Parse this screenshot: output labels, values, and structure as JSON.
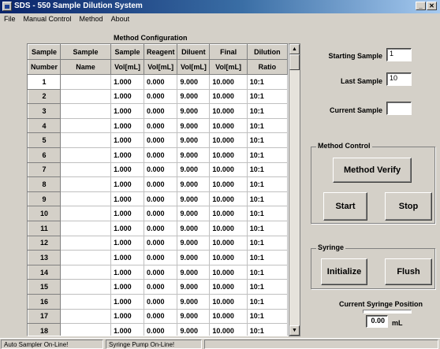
{
  "window": {
    "title": "SDS - 550 Sample Dilution System"
  },
  "menu": [
    "File",
    "Manual Control",
    "Method",
    "About"
  ],
  "method_config": {
    "title": "Method Configuration",
    "headers": [
      [
        "Sample",
        "Number"
      ],
      [
        "Sample",
        "Name"
      ],
      [
        "Sample",
        "Vol[mL]"
      ],
      [
        "Reagent",
        "Vol[mL]"
      ],
      [
        "Diluent",
        "Vol[mL]"
      ],
      [
        "Final",
        "Vol[mL]"
      ],
      [
        "Dilution",
        "Ratio"
      ]
    ],
    "rows": [
      [
        "1",
        "",
        "1.000",
        "0.000",
        "9.000",
        "10.000",
        "10:1"
      ],
      [
        "2",
        "",
        "1.000",
        "0.000",
        "9.000",
        "10.000",
        "10:1"
      ],
      [
        "3",
        "",
        "1.000",
        "0.000",
        "9.000",
        "10.000",
        "10:1"
      ],
      [
        "4",
        "",
        "1.000",
        "0.000",
        "9.000",
        "10.000",
        "10:1"
      ],
      [
        "5",
        "",
        "1.000",
        "0.000",
        "9.000",
        "10.000",
        "10:1"
      ],
      [
        "6",
        "",
        "1.000",
        "0.000",
        "9.000",
        "10.000",
        "10:1"
      ],
      [
        "7",
        "",
        "1.000",
        "0.000",
        "9.000",
        "10.000",
        "10:1"
      ],
      [
        "8",
        "",
        "1.000",
        "0.000",
        "9.000",
        "10.000",
        "10:1"
      ],
      [
        "9",
        "",
        "1.000",
        "0.000",
        "9.000",
        "10.000",
        "10:1"
      ],
      [
        "10",
        "",
        "1.000",
        "0.000",
        "9.000",
        "10.000",
        "10:1"
      ],
      [
        "11",
        "",
        "1.000",
        "0.000",
        "9.000",
        "10.000",
        "10:1"
      ],
      [
        "12",
        "",
        "1.000",
        "0.000",
        "9.000",
        "10.000",
        "10:1"
      ],
      [
        "13",
        "",
        "1.000",
        "0.000",
        "9.000",
        "10.000",
        "10:1"
      ],
      [
        "14",
        "",
        "1.000",
        "0.000",
        "9.000",
        "10.000",
        "10:1"
      ],
      [
        "15",
        "",
        "1.000",
        "0.000",
        "9.000",
        "10.000",
        "10:1"
      ],
      [
        "16",
        "",
        "1.000",
        "0.000",
        "9.000",
        "10.000",
        "10:1"
      ],
      [
        "17",
        "",
        "1.000",
        "0.000",
        "9.000",
        "10.000",
        "10:1"
      ],
      [
        "18",
        "",
        "1.000",
        "0.000",
        "9.000",
        "10.000",
        "10:1"
      ]
    ]
  },
  "settings": {
    "starting_sample_label": "Starting Sample",
    "starting_sample_value": "1",
    "last_sample_label": "Last Sample",
    "last_sample_value": "10",
    "current_sample_label": "Current Sample",
    "current_sample_value": ""
  },
  "method_control": {
    "title": "Method Control",
    "verify_label": "Method Verify",
    "start_label": "Start",
    "stop_label": "Stop"
  },
  "syringe": {
    "title": "Syringe",
    "initialize_label": "Initialize",
    "flush_label": "Flush",
    "position_label": "Current Syringe Position",
    "position_value": "0.00",
    "position_unit": "mL"
  },
  "status": {
    "autosampler": "Auto Sampler On-Line!",
    "syringe_pump": "Syringe Pump On-Line!"
  },
  "colors": {
    "titlebar": "#0a246a",
    "face": "#d4d0c8"
  }
}
